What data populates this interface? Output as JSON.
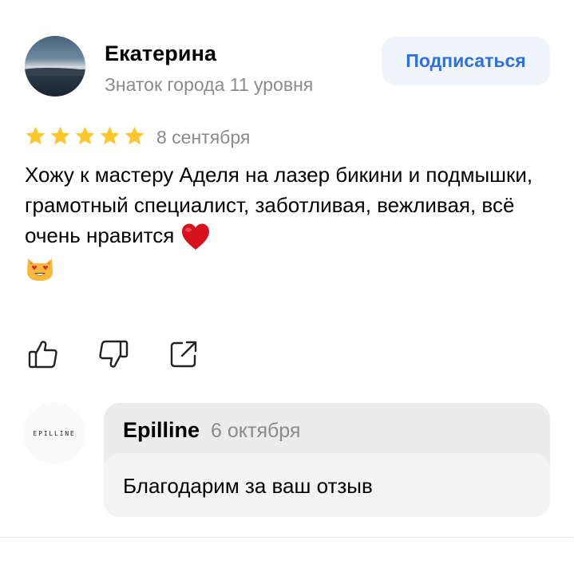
{
  "review": {
    "author_name": "Екатерина",
    "author_level": "Знаток города 11 уровня",
    "subscribe_label": "Подписаться",
    "rating": 5,
    "date": "8 сентября",
    "text": "Хожу к мастеру Аделя на лазер бикини и подмышки, грамотный специалист, заботливая, вежливая, всё очень нравится",
    "actions": [
      "like-icon",
      "dislike-icon",
      "share-icon"
    ]
  },
  "reply": {
    "logo_text": "EPILLINE",
    "author": "Epilline",
    "date": "6 октября",
    "text": "Благодарим за ваш отзыв"
  },
  "colors": {
    "accent": "#2f6fe4",
    "button_bg": "#f0f4fb",
    "star": "#fcc72c",
    "muted_text": "#8b8b8f",
    "reply_bg": "#ececec",
    "reply_body_bg": "#f3f3f4"
  }
}
